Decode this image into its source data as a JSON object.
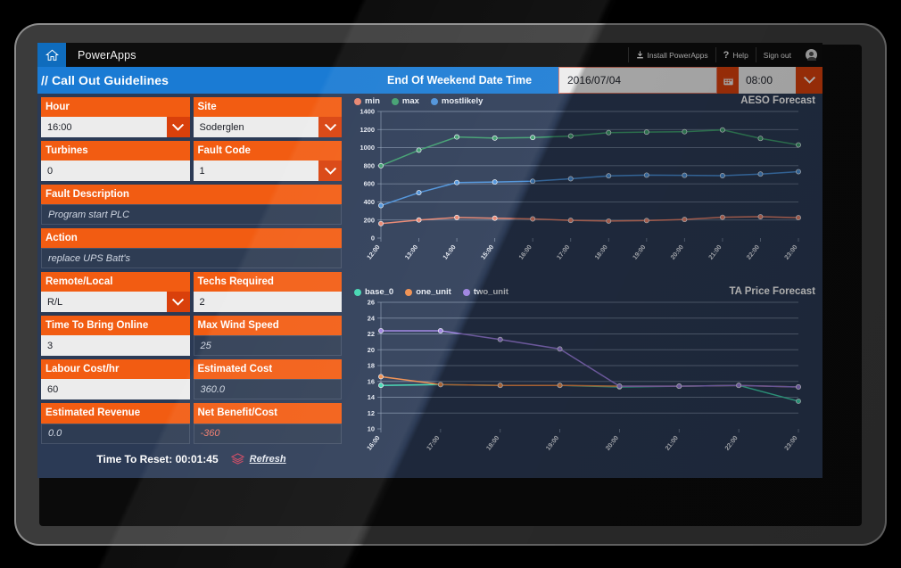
{
  "powerapps_bar": {
    "home_icon": "home-icon",
    "title": "PowerApps",
    "install_label": "Install PowerApps",
    "install_icon": "download-icon",
    "help_label": "Help",
    "help_icon": "question-mark-icon",
    "signout_label": "Sign out",
    "avatar_icon": "account-avatar-icon"
  },
  "app_header": {
    "title": "// Call Out Guidelines",
    "datetime_label": "End Of Weekend Date Time",
    "date_value": "2016/07/04",
    "calendar_icon": "calendar-icon",
    "time_value": "08:00",
    "time_chevron_icon": "chevron-down-icon"
  },
  "form": {
    "fields": [
      {
        "label": "Hour",
        "value": "16:00",
        "kind": "dropdown"
      },
      {
        "label": "Site",
        "value": "Soderglen",
        "kind": "dropdown"
      },
      {
        "label": "Turbines",
        "value": "0",
        "kind": "input"
      },
      {
        "label": "Fault Code",
        "value": "1",
        "kind": "dropdown"
      },
      {
        "label": "Fault Description",
        "value": "Program start PLC",
        "kind": "readonly"
      },
      {
        "label": "Action",
        "value": "replace UPS Batt's",
        "kind": "readonly"
      },
      {
        "label": "Remote/Local",
        "value": "R/L",
        "kind": "dropdown"
      },
      {
        "label": "Techs Required",
        "value": "2",
        "kind": "input"
      },
      {
        "label": "Time To Bring Online",
        "value": "3",
        "kind": "input"
      },
      {
        "label": "Max Wind Speed",
        "value": "25",
        "kind": "readonly"
      },
      {
        "label": "Labour Cost/hr",
        "value": "60",
        "kind": "input"
      },
      {
        "label": "Estimated Cost",
        "value": "360.0",
        "kind": "readonly"
      },
      {
        "label": "Estimated Revenue",
        "value": "0.0",
        "kind": "readonly"
      },
      {
        "label": "Net Benefit/Cost",
        "value": "-360",
        "kind": "readonly-negative"
      }
    ],
    "footer": {
      "reset_text": "Time To Reset: 00:01:45",
      "refresh_label": "Refresh",
      "refresh_icon": "layers-diamond-icon"
    }
  },
  "colors": {
    "orange": "#f25c12",
    "orange_dark": "#d9400b",
    "blue_header": "#1a7bd4",
    "screen_bg": "#2b3a55",
    "series_min": "#e8836d",
    "series_max": "#3e9e6e",
    "series_mostlikely": "#4a90d9",
    "series_base_0": "#3fd6b0",
    "series_one_unit": "#f08c4a",
    "series_two_unit": "#9b7fe0"
  },
  "chart_data": [
    {
      "type": "line",
      "title": "AESO Forecast",
      "xlabel": "",
      "ylabel": "",
      "ylim": [
        0,
        1400
      ],
      "yticks": [
        0,
        200,
        400,
        600,
        800,
        1000,
        1200,
        1400
      ],
      "grid": true,
      "legend_position": "top-left",
      "categories": [
        "12:00",
        "13:00",
        "14:00",
        "15:00",
        "16:00",
        "17:00",
        "18:00",
        "19:00",
        "20:00",
        "21:00",
        "22:00",
        "23:00"
      ],
      "series": [
        {
          "name": "min",
          "color": "#e8836d",
          "values": [
            160,
            200,
            228,
            220,
            212,
            196,
            188,
            194,
            206,
            230,
            236,
            226
          ]
        },
        {
          "name": "max",
          "color": "#3e9e6e",
          "values": [
            800,
            972,
            1118,
            1106,
            1112,
            1128,
            1166,
            1172,
            1176,
            1196,
            1102,
            1030
          ]
        },
        {
          "name": "mostlikely",
          "color": "#4a90d9",
          "values": [
            360,
            502,
            614,
            620,
            628,
            656,
            688,
            696,
            694,
            690,
            708,
            734
          ]
        }
      ]
    },
    {
      "type": "line",
      "title": "TA Price Forecast",
      "xlabel": "",
      "ylabel": "",
      "ylim": [
        10,
        26
      ],
      "yticks": [
        10,
        12,
        14,
        16,
        18,
        20,
        22,
        24,
        26
      ],
      "grid": true,
      "legend_position": "top-left",
      "categories": [
        "16:00",
        "17:00",
        "18:00",
        "19:00",
        "20:00",
        "21:00",
        "22:00",
        "23:00"
      ],
      "series": [
        {
          "name": "base_0",
          "color": "#3fd6b0",
          "values": [
            15.5,
            15.6,
            15.5,
            15.5,
            15.3,
            15.4,
            15.5,
            13.5
          ]
        },
        {
          "name": "one_unit",
          "color": "#f08c4a",
          "values": [
            16.6,
            15.6,
            15.5,
            15.5,
            15.4,
            15.4,
            15.5,
            15.3
          ]
        },
        {
          "name": "two_unit",
          "color": "#9b7fe0",
          "values": [
            22.4,
            22.4,
            21.3,
            20.1,
            15.4,
            15.4,
            15.5,
            15.3
          ]
        }
      ]
    }
  ]
}
